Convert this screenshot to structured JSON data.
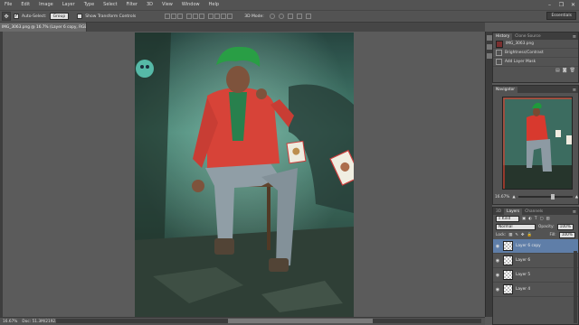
{
  "menu": [
    "File",
    "Edit",
    "Image",
    "Layer",
    "Type",
    "Select",
    "Filter",
    "3D",
    "View",
    "Window",
    "Help"
  ],
  "window_controls": {
    "minimize": "–",
    "restore": "❐",
    "close": "✕"
  },
  "options": {
    "auto_select_label": "Auto-Select:",
    "auto_select_target": "Group",
    "show_transform_label": "Show Transform Controls",
    "mode_3d_label": "3D Mode:"
  },
  "workspace": "Essentials",
  "document_tab": "IMG_3063.png @ 16.7% (Layer 6 copy, RGB/8) *",
  "status": {
    "zoom": "16.67%",
    "doc": "Doc: 51.3M/2192.2M"
  },
  "history": {
    "tabs": [
      "History",
      "Clone Source"
    ],
    "snapshot": "IMG_3063.png",
    "steps": [
      "Brightness/Contrast",
      "Add Layer Mask"
    ]
  },
  "navigator": {
    "tab": "Navigator",
    "zoom": "16.67%"
  },
  "layers": {
    "tabs": [
      "3D",
      "Layers",
      "Channels"
    ],
    "filter_kind": "Kind",
    "blend_mode": "Normal",
    "opacity_label": "Opacity:",
    "opacity": "100%",
    "lock_label": "Lock:",
    "fill_label": "Fill:",
    "fill": "100%",
    "items": [
      {
        "name": "Layer 6 copy",
        "selected": true
      },
      {
        "name": "Layer 6",
        "selected": false
      },
      {
        "name": "Layer 5",
        "selected": false
      },
      {
        "name": "Layer 4",
        "selected": false
      }
    ]
  },
  "colors": {
    "accent_selected": "#5f7ea8",
    "jacket": "#d8392e",
    "hair": "#1f9a3c",
    "scene": "#2f6a5a"
  }
}
